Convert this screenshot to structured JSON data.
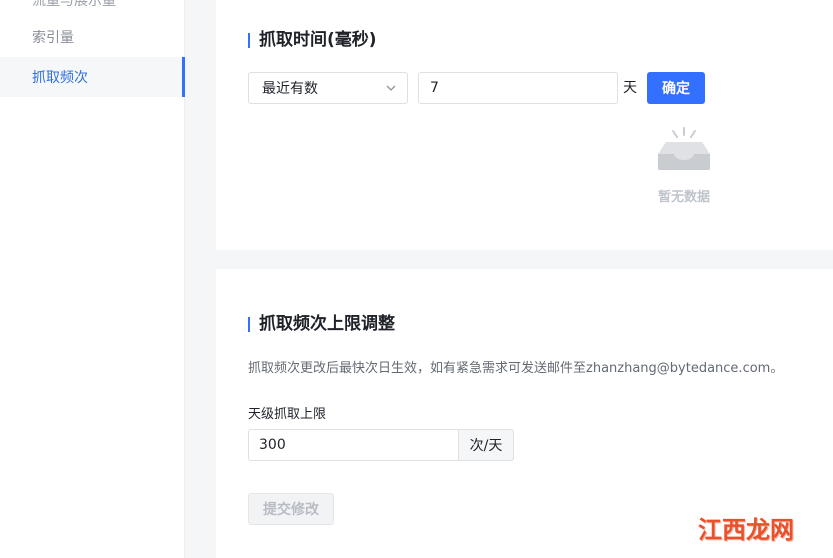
{
  "sidebar": {
    "items": [
      {
        "label": "流量与展示量"
      },
      {
        "label": "索引量"
      },
      {
        "label": "抓取频次"
      }
    ]
  },
  "crawl_time": {
    "title": "抓取时间(毫秒)",
    "range_select": {
      "value": "最近有数"
    },
    "days_input": {
      "value": "7"
    },
    "days_unit": "天",
    "confirm_label": "确定",
    "empty_text": "暂无数据"
  },
  "crawl_limit": {
    "title": "抓取频次上限调整",
    "description": "抓取频次更改后最快次日生效，如有紧急需求可发送邮件至zhanzhang@bytedance.com。",
    "field_label": "天级抓取上限",
    "limit_input": {
      "value": "300"
    },
    "limit_unit": "次/天",
    "submit_label": "提交修改"
  },
  "watermark": {
    "text": "江西龙网"
  },
  "colors": {
    "accent": "#3370ff",
    "watermark": "#e9512d"
  }
}
